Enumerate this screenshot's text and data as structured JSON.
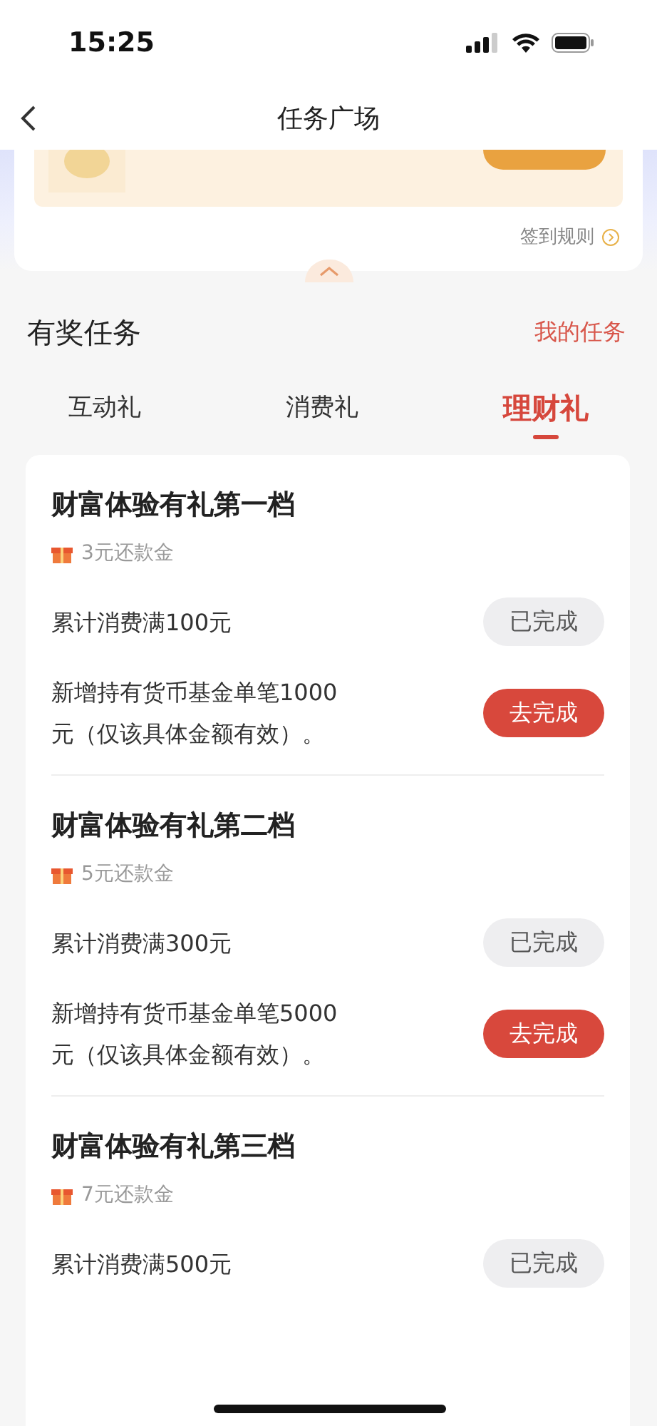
{
  "status_bar": {
    "time": "15:25"
  },
  "nav": {
    "title": "任务广场"
  },
  "signin": {
    "rules_link": "签到规则"
  },
  "section": {
    "title": "有奖任务",
    "link": "我的任务"
  },
  "tabs": [
    {
      "label": "互动礼",
      "selected": false
    },
    {
      "label": "消费礼",
      "selected": false
    },
    {
      "label": "理财礼",
      "selected": true
    }
  ],
  "task_groups": [
    {
      "title": "财富体验有礼第一档",
      "reward": "3元还款金",
      "tasks": [
        {
          "text": "累计消费满100元",
          "button": "已完成",
          "done": true
        },
        {
          "text": "新增持有货币基金单笔1000元（仅该具体金额有效）。",
          "button": "去完成",
          "done": false
        }
      ]
    },
    {
      "title": "财富体验有礼第二档",
      "reward": "5元还款金",
      "tasks": [
        {
          "text": "累计消费满300元",
          "button": "已完成",
          "done": true
        },
        {
          "text": "新增持有货币基金单笔5000元（仅该具体金额有效）。",
          "button": "去完成",
          "done": false
        }
      ]
    },
    {
      "title": "财富体验有礼第三档",
      "reward": "7元还款金",
      "tasks": [
        {
          "text": "累计消费满500元",
          "button": "已完成",
          "done": true
        }
      ]
    }
  ]
}
